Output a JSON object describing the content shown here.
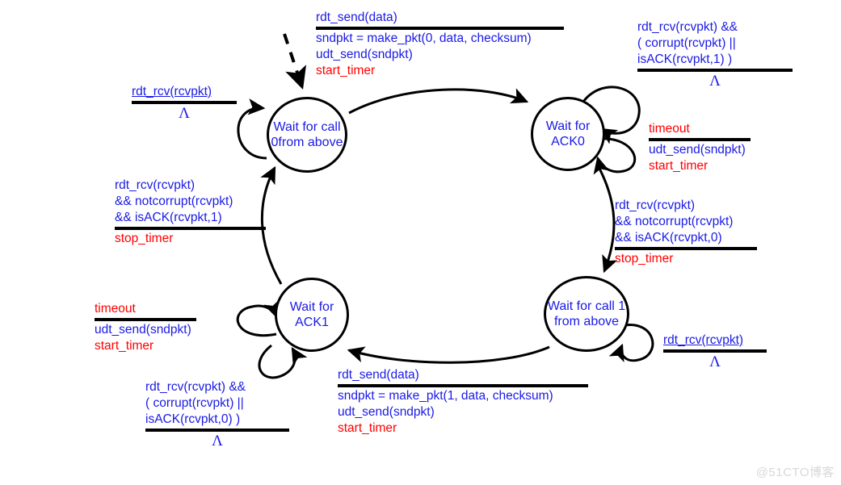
{
  "diagram": {
    "title": "rdt3.0 sender FSM",
    "colors": {
      "action": "#1a1ae6",
      "timer": "#ff0000",
      "stroke": "#000000",
      "watermark": "#d8d8d8"
    },
    "lambda": "Λ"
  },
  "states": [
    {
      "id": "wait-call-0",
      "lines": [
        "Wait for",
        "call 0from",
        "above"
      ]
    },
    {
      "id": "wait-ack-0",
      "lines": [
        "Wait",
        "for",
        "ACK0"
      ]
    },
    {
      "id": "wait-call-1",
      "lines": [
        "Wait for",
        "call 1 from",
        "above"
      ]
    },
    {
      "id": "wait-ack-1",
      "lines": [
        "Wait",
        "for",
        "ACK1"
      ]
    }
  ],
  "notes": {
    "top_center": {
      "name": "rdt-send-0-note",
      "event": "rdt_send(data)",
      "actions": [
        "sndpkt = make_pkt(0, data, checksum)",
        "udt_send(sndpkt)"
      ],
      "timer_action": "start_timer"
    },
    "top_right": {
      "name": "ack0-corrupt-note",
      "condition": [
        "rdt_rcv(rcvpkt) &&",
        "( corrupt(rcvpkt) ||",
        "isACK(rcvpkt,1) )"
      ],
      "action": "Λ"
    },
    "right_timeout": {
      "name": "ack0-timeout-note",
      "event": "timeout",
      "actions": [
        "udt_send(sndpkt)"
      ],
      "timer_action": "start_timer"
    },
    "mid_right": {
      "name": "ack0-good-note",
      "condition": [
        "rdt_rcv(rcvpkt)",
        "&& notcorrupt(rcvpkt)",
        "&& isACK(rcvpkt,0)"
      ],
      "timer_action": "stop_timer"
    },
    "bottom_right": {
      "name": "call1-rdt-rcv-note",
      "event": "rdt_rcv(rcvpkt)",
      "action": "Λ"
    },
    "bottom_center": {
      "name": "rdt-send-1-note",
      "event": "rdt_send(data)",
      "actions": [
        "sndpkt = make_pkt(1, data, checksum)",
        "udt_send(sndpkt)"
      ],
      "timer_action": "start_timer"
    },
    "bottom_left": {
      "name": "ack1-corrupt-note",
      "condition": [
        "rdt_rcv(rcvpkt) &&",
        "( corrupt(rcvpkt) ||",
        "isACK(rcvpkt,0) )"
      ],
      "action": "Λ"
    },
    "left_timeout": {
      "name": "ack1-timeout-note",
      "event": "timeout",
      "actions": [
        "udt_send(sndpkt)"
      ],
      "timer_action": "start_timer"
    },
    "mid_left": {
      "name": "ack1-good-note",
      "condition": [
        "rdt_rcv(rcvpkt)",
        "&& notcorrupt(rcvpkt)",
        "&& isACK(rcvpkt,1)"
      ],
      "timer_action": "stop_timer"
    },
    "top_left": {
      "name": "call0-rdt-rcv-note",
      "event": "rdt_rcv(rcvpkt)",
      "action": "Λ"
    }
  },
  "watermark": {
    "text": "@51CTO博客"
  }
}
